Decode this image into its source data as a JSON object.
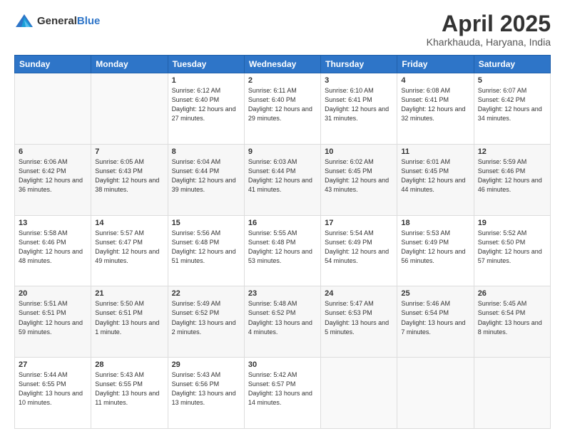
{
  "header": {
    "logo_general": "General",
    "logo_blue": "Blue",
    "title": "April 2025",
    "location": "Kharkhauda, Haryana, India"
  },
  "weekdays": [
    "Sunday",
    "Monday",
    "Tuesday",
    "Wednesday",
    "Thursday",
    "Friday",
    "Saturday"
  ],
  "weeks": [
    [
      {
        "day": null,
        "sunrise": null,
        "sunset": null,
        "daylight": null
      },
      {
        "day": null,
        "sunrise": null,
        "sunset": null,
        "daylight": null
      },
      {
        "day": "1",
        "sunrise": "Sunrise: 6:12 AM",
        "sunset": "Sunset: 6:40 PM",
        "daylight": "Daylight: 12 hours and 27 minutes."
      },
      {
        "day": "2",
        "sunrise": "Sunrise: 6:11 AM",
        "sunset": "Sunset: 6:40 PM",
        "daylight": "Daylight: 12 hours and 29 minutes."
      },
      {
        "day": "3",
        "sunrise": "Sunrise: 6:10 AM",
        "sunset": "Sunset: 6:41 PM",
        "daylight": "Daylight: 12 hours and 31 minutes."
      },
      {
        "day": "4",
        "sunrise": "Sunrise: 6:08 AM",
        "sunset": "Sunset: 6:41 PM",
        "daylight": "Daylight: 12 hours and 32 minutes."
      },
      {
        "day": "5",
        "sunrise": "Sunrise: 6:07 AM",
        "sunset": "Sunset: 6:42 PM",
        "daylight": "Daylight: 12 hours and 34 minutes."
      }
    ],
    [
      {
        "day": "6",
        "sunrise": "Sunrise: 6:06 AM",
        "sunset": "Sunset: 6:42 PM",
        "daylight": "Daylight: 12 hours and 36 minutes."
      },
      {
        "day": "7",
        "sunrise": "Sunrise: 6:05 AM",
        "sunset": "Sunset: 6:43 PM",
        "daylight": "Daylight: 12 hours and 38 minutes."
      },
      {
        "day": "8",
        "sunrise": "Sunrise: 6:04 AM",
        "sunset": "Sunset: 6:44 PM",
        "daylight": "Daylight: 12 hours and 39 minutes."
      },
      {
        "day": "9",
        "sunrise": "Sunrise: 6:03 AM",
        "sunset": "Sunset: 6:44 PM",
        "daylight": "Daylight: 12 hours and 41 minutes."
      },
      {
        "day": "10",
        "sunrise": "Sunrise: 6:02 AM",
        "sunset": "Sunset: 6:45 PM",
        "daylight": "Daylight: 12 hours and 43 minutes."
      },
      {
        "day": "11",
        "sunrise": "Sunrise: 6:01 AM",
        "sunset": "Sunset: 6:45 PM",
        "daylight": "Daylight: 12 hours and 44 minutes."
      },
      {
        "day": "12",
        "sunrise": "Sunrise: 5:59 AM",
        "sunset": "Sunset: 6:46 PM",
        "daylight": "Daylight: 12 hours and 46 minutes."
      }
    ],
    [
      {
        "day": "13",
        "sunrise": "Sunrise: 5:58 AM",
        "sunset": "Sunset: 6:46 PM",
        "daylight": "Daylight: 12 hours and 48 minutes."
      },
      {
        "day": "14",
        "sunrise": "Sunrise: 5:57 AM",
        "sunset": "Sunset: 6:47 PM",
        "daylight": "Daylight: 12 hours and 49 minutes."
      },
      {
        "day": "15",
        "sunrise": "Sunrise: 5:56 AM",
        "sunset": "Sunset: 6:48 PM",
        "daylight": "Daylight: 12 hours and 51 minutes."
      },
      {
        "day": "16",
        "sunrise": "Sunrise: 5:55 AM",
        "sunset": "Sunset: 6:48 PM",
        "daylight": "Daylight: 12 hours and 53 minutes."
      },
      {
        "day": "17",
        "sunrise": "Sunrise: 5:54 AM",
        "sunset": "Sunset: 6:49 PM",
        "daylight": "Daylight: 12 hours and 54 minutes."
      },
      {
        "day": "18",
        "sunrise": "Sunrise: 5:53 AM",
        "sunset": "Sunset: 6:49 PM",
        "daylight": "Daylight: 12 hours and 56 minutes."
      },
      {
        "day": "19",
        "sunrise": "Sunrise: 5:52 AM",
        "sunset": "Sunset: 6:50 PM",
        "daylight": "Daylight: 12 hours and 57 minutes."
      }
    ],
    [
      {
        "day": "20",
        "sunrise": "Sunrise: 5:51 AM",
        "sunset": "Sunset: 6:51 PM",
        "daylight": "Daylight: 12 hours and 59 minutes."
      },
      {
        "day": "21",
        "sunrise": "Sunrise: 5:50 AM",
        "sunset": "Sunset: 6:51 PM",
        "daylight": "Daylight: 13 hours and 1 minute."
      },
      {
        "day": "22",
        "sunrise": "Sunrise: 5:49 AM",
        "sunset": "Sunset: 6:52 PM",
        "daylight": "Daylight: 13 hours and 2 minutes."
      },
      {
        "day": "23",
        "sunrise": "Sunrise: 5:48 AM",
        "sunset": "Sunset: 6:52 PM",
        "daylight": "Daylight: 13 hours and 4 minutes."
      },
      {
        "day": "24",
        "sunrise": "Sunrise: 5:47 AM",
        "sunset": "Sunset: 6:53 PM",
        "daylight": "Daylight: 13 hours and 5 minutes."
      },
      {
        "day": "25",
        "sunrise": "Sunrise: 5:46 AM",
        "sunset": "Sunset: 6:54 PM",
        "daylight": "Daylight: 13 hours and 7 minutes."
      },
      {
        "day": "26",
        "sunrise": "Sunrise: 5:45 AM",
        "sunset": "Sunset: 6:54 PM",
        "daylight": "Daylight: 13 hours and 8 minutes."
      }
    ],
    [
      {
        "day": "27",
        "sunrise": "Sunrise: 5:44 AM",
        "sunset": "Sunset: 6:55 PM",
        "daylight": "Daylight: 13 hours and 10 minutes."
      },
      {
        "day": "28",
        "sunrise": "Sunrise: 5:43 AM",
        "sunset": "Sunset: 6:55 PM",
        "daylight": "Daylight: 13 hours and 11 minutes."
      },
      {
        "day": "29",
        "sunrise": "Sunrise: 5:43 AM",
        "sunset": "Sunset: 6:56 PM",
        "daylight": "Daylight: 13 hours and 13 minutes."
      },
      {
        "day": "30",
        "sunrise": "Sunrise: 5:42 AM",
        "sunset": "Sunset: 6:57 PM",
        "daylight": "Daylight: 13 hours and 14 minutes."
      },
      {
        "day": null,
        "sunrise": null,
        "sunset": null,
        "daylight": null
      },
      {
        "day": null,
        "sunrise": null,
        "sunset": null,
        "daylight": null
      },
      {
        "day": null,
        "sunrise": null,
        "sunset": null,
        "daylight": null
      }
    ]
  ]
}
